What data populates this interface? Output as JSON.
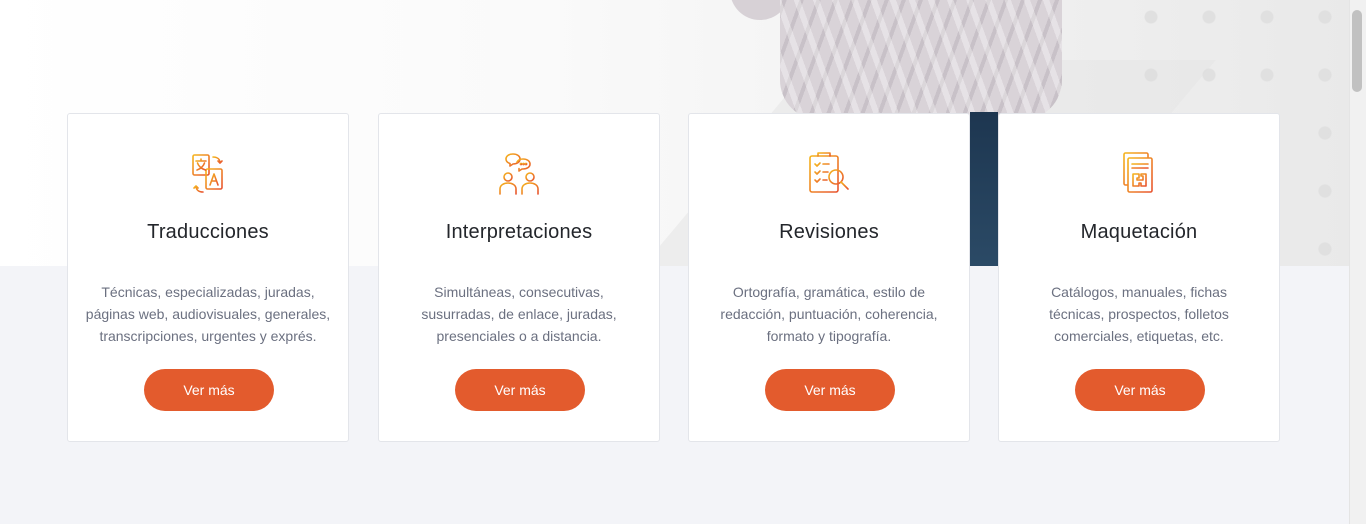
{
  "colors": {
    "accent": "#e35b2d",
    "icon_gradient_start": "#f5b51d",
    "icon_gradient_end": "#e8532f",
    "page_bg": "#f3f4f8"
  },
  "services": [
    {
      "icon": "translate-icon",
      "title": "Traducciones",
      "lines": [
        "Técnicas, especializadas, juradas,",
        "páginas web, audiovisuales, generales,",
        "transcripciones, urgentes y exprés."
      ],
      "button_label": "Ver más"
    },
    {
      "icon": "interpreters-chat-icon",
      "title": "Interpretaciones",
      "lines": [
        "Simultáneas, consecutivas,",
        "susurradas, de enlace, juradas,",
        "presenciales o a distancia."
      ],
      "button_label": "Ver más"
    },
    {
      "icon": "clipboard-magnifier-icon",
      "title": "Revisiones",
      "lines": [
        "Ortografía, gramática, estilo de",
        "redacción, puntuación, coherencia,",
        "formato y tipografía."
      ],
      "button_label": "Ver más"
    },
    {
      "icon": "document-layout-icon",
      "title": "Maquetación",
      "lines": [
        "Catálogos, manuales, fichas",
        "técnicas, prospectos, folletos",
        "comerciales, etiquetas, etc."
      ],
      "button_label": "Ver más"
    }
  ]
}
